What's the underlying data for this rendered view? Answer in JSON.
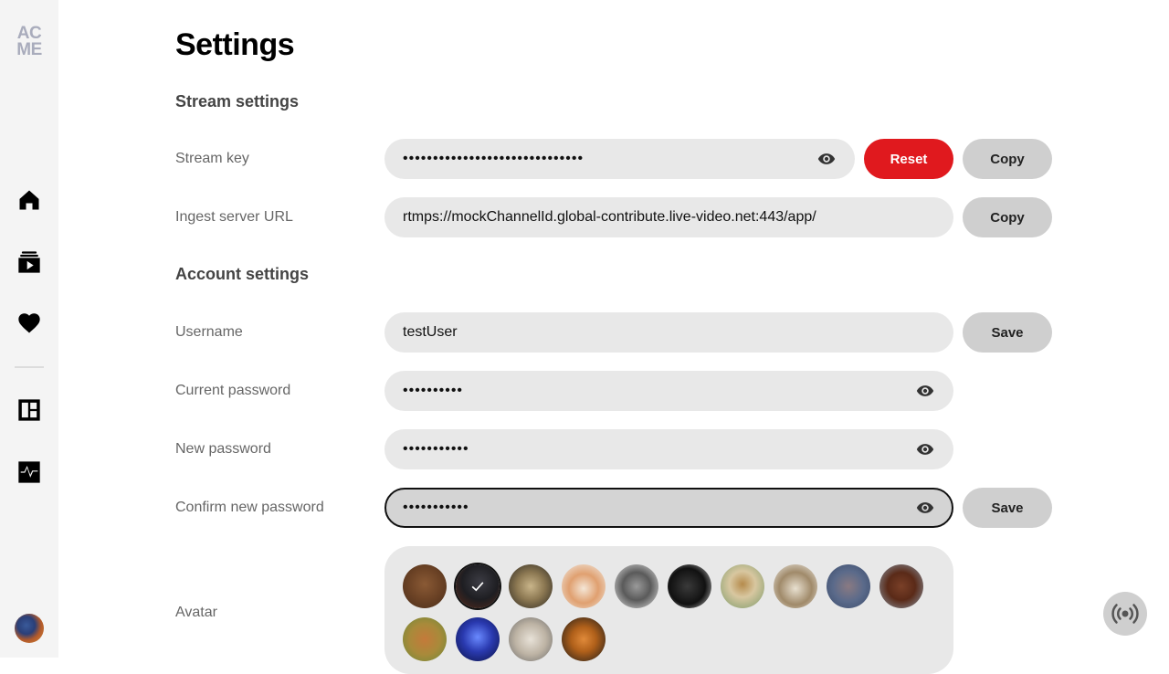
{
  "logo": {
    "line1": "AC",
    "line2": "ME"
  },
  "page": {
    "title": "Settings"
  },
  "sections": {
    "stream": "Stream settings",
    "account": "Account settings"
  },
  "stream_key": {
    "label": "Stream key",
    "value": "••••••••••••••••••••••••••••••",
    "reset": "Reset",
    "copy": "Copy"
  },
  "ingest": {
    "label": "Ingest server URL",
    "value": "rtmps://mockChannelId.global-contribute.live-video.net:443/app/",
    "copy": "Copy"
  },
  "username": {
    "label": "Username",
    "value": "testUser",
    "save": "Save"
  },
  "current_password": {
    "label": "Current password",
    "value": "••••••••••"
  },
  "new_password": {
    "label": "New password",
    "value": "•••••••••••"
  },
  "confirm_password": {
    "label": "Confirm new password",
    "value": "•••••••••••",
    "save": "Save"
  },
  "avatar": {
    "label": "Avatar",
    "selected": "eagle",
    "options": [
      "bear",
      "eagle",
      "owl",
      "shiba",
      "pitbull",
      "pug",
      "giraffe",
      "hedgehog",
      "hippo",
      "horse",
      "gazelle",
      "jellyfish",
      "lamb",
      "tiger"
    ]
  },
  "nav": {
    "items": [
      "home-icon",
      "video-library-icon",
      "heart-icon",
      "dashboard-icon",
      "activity-icon"
    ]
  },
  "colors": {
    "accent_red": "#e0191e",
    "sidebar_bg": "#f4f4f4",
    "field_bg": "#e8e8e8",
    "button_grey": "#cfcfcf"
  }
}
